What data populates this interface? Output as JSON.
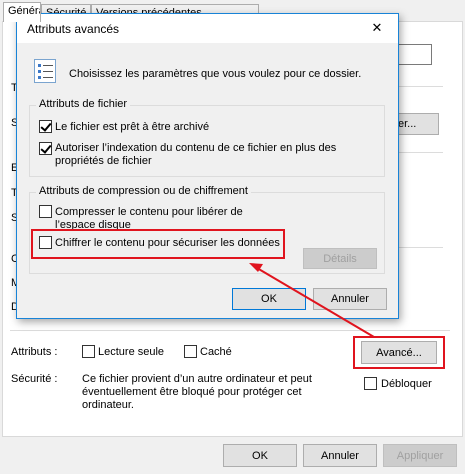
{
  "properties": {
    "tabs": [
      {
        "label": "Général",
        "selected": true
      },
      {
        "label": "Sécurité"
      },
      {
        "label": "Versions précédentes"
      }
    ],
    "side_letters": [
      "T",
      "S",
      "E",
      "T",
      "S",
      "C",
      "M",
      "D"
    ],
    "partial_button_label": "er...",
    "attributes_label": "Attributs :",
    "readonly_label": "Lecture seule",
    "hidden_label": "Caché",
    "advanced_button": "Avancé...",
    "security_label": "Sécurité :",
    "security_text": "Ce fichier provient d’un autre ordinateur et peut éventuellement être bloqué pour protéger cet ordinateur.",
    "unblock_label": "Débloquer",
    "ok": "OK",
    "cancel": "Annuler",
    "apply": "Appliquer"
  },
  "dialog": {
    "title": "Attributs avancés",
    "close_glyph": "✕",
    "intro": "Choisissez les paramètres que vous voulez pour ce dossier.",
    "file_attrs_title": "Attributs de fichier",
    "archive_label": "Le fichier est prêt à être archivé",
    "archive_checked": true,
    "index_label": "Autoriser l’indexation du contenu de ce fichier en plus des propriétés de fichier",
    "index_checked": true,
    "compress_title": "Attributs de compression ou de chiffrement",
    "compress_label": "Compresser le contenu pour libérer de l’espace disque",
    "compress_checked": false,
    "encrypt_label": "Chiffrer le contenu pour sécuriser les données",
    "encrypt_checked": false,
    "details_button": "Détails",
    "ok": "OK",
    "cancel": "Annuler"
  },
  "colors": {
    "highlight": "#e0141e",
    "dialog_border": "#1883d7"
  }
}
